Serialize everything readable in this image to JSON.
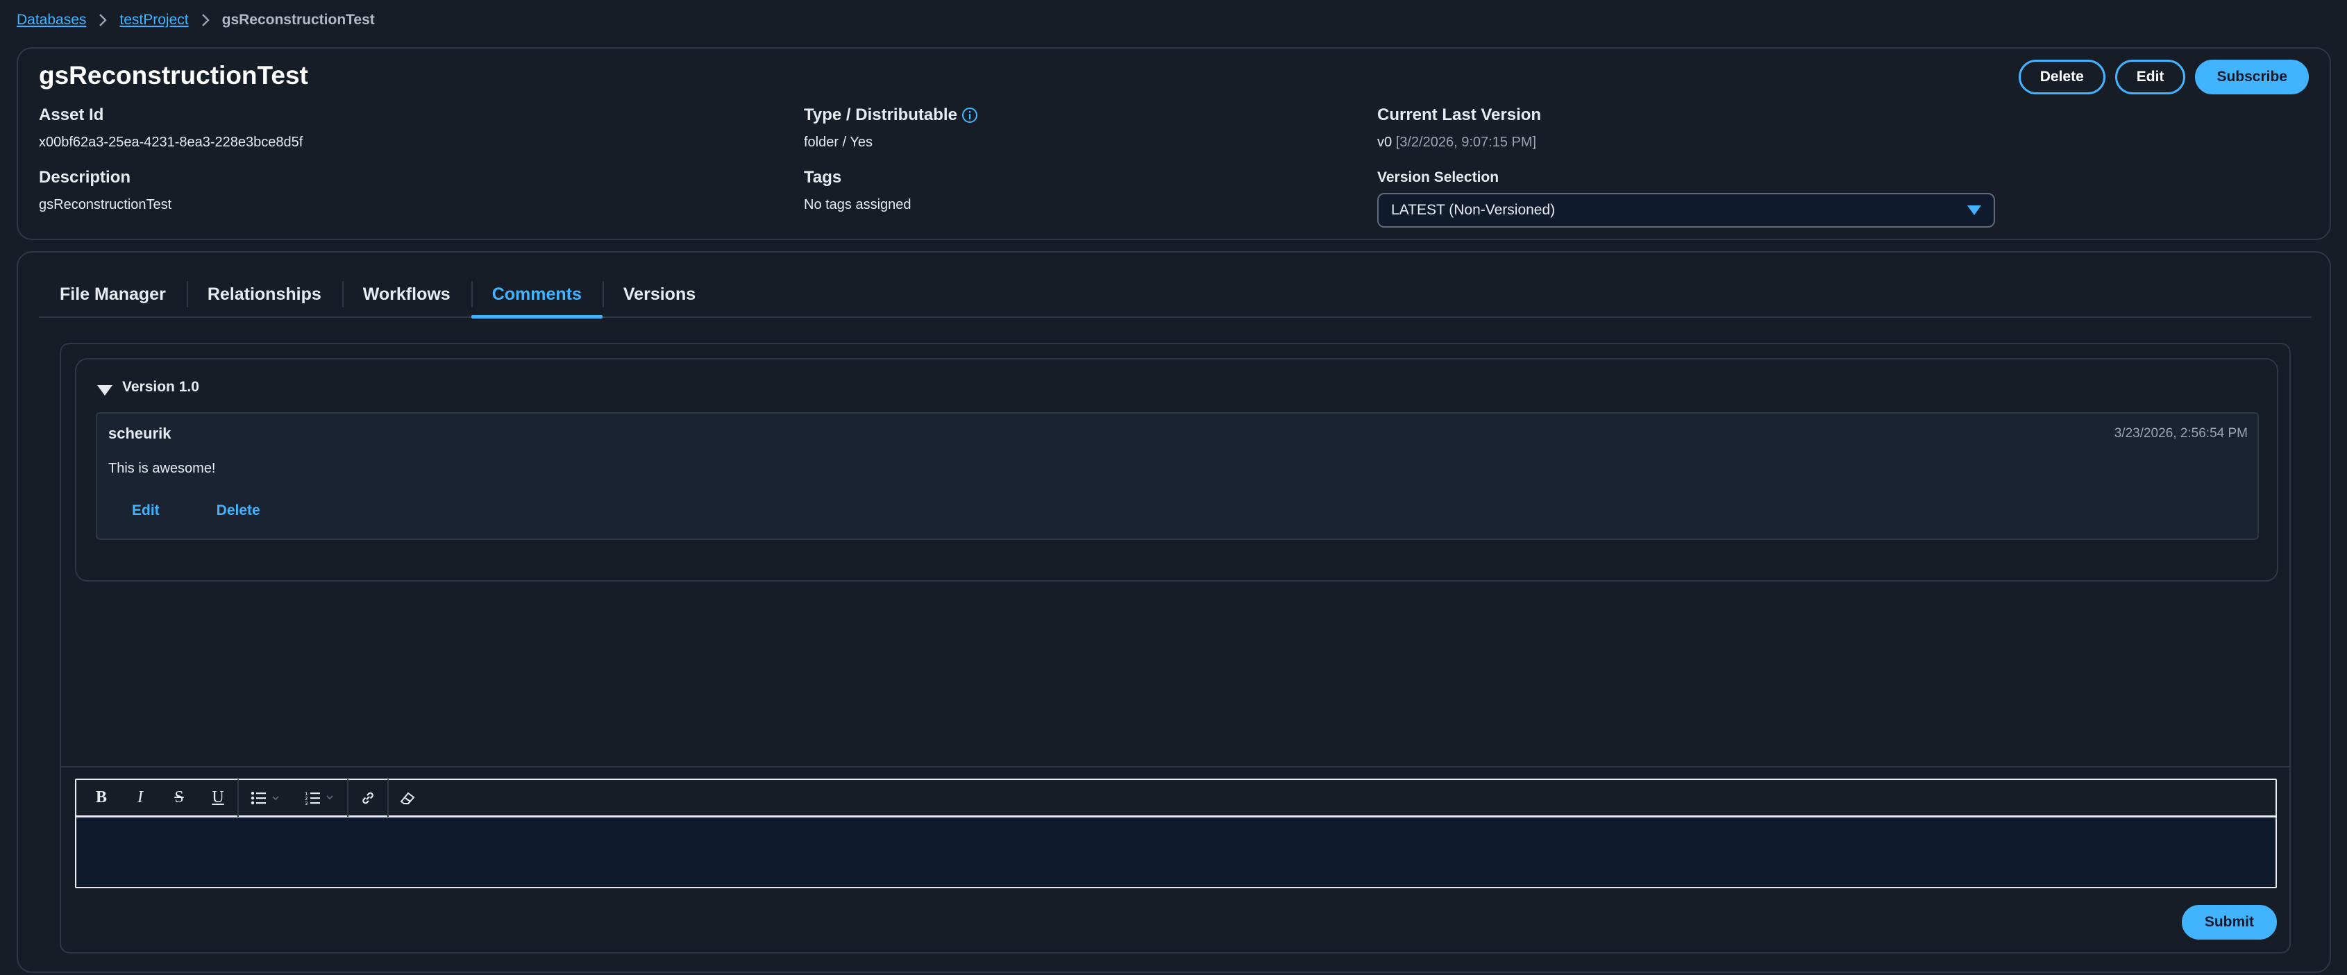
{
  "breadcrumb": {
    "items": [
      {
        "label": "Databases"
      },
      {
        "label": "testProject"
      }
    ],
    "current": "gsReconstructionTest"
  },
  "asset": {
    "title": "gsReconstructionTest",
    "actions": {
      "delete": "Delete",
      "edit": "Edit",
      "subscribe": "Subscribe"
    },
    "fields": {
      "asset_id": {
        "label": "Asset Id",
        "value": "x00bf62a3-25ea-4231-8ea3-228e3bce8d5f"
      },
      "type": {
        "label": "Type / Distributable",
        "value": "folder / Yes"
      },
      "current_version": {
        "label": "Current Last Version",
        "version": "v0",
        "date": "[3/2/2026, 9:07:15 PM]"
      },
      "description": {
        "label": "Description",
        "value": "gsReconstructionTest"
      },
      "tags": {
        "label": "Tags",
        "value": "No tags assigned"
      },
      "version_selection": {
        "label": "Version Selection",
        "value": "LATEST (Non-Versioned)"
      }
    }
  },
  "tabs": [
    {
      "label": "File Manager",
      "active": false
    },
    {
      "label": "Relationships",
      "active": false
    },
    {
      "label": "Workflows",
      "active": false
    },
    {
      "label": "Comments",
      "active": true
    },
    {
      "label": "Versions",
      "active": false
    }
  ],
  "comments": {
    "groups": [
      {
        "title": "Version 1.0",
        "comments": [
          {
            "author": "scheurik",
            "timestamp": "3/23/2026, 2:56:54 PM",
            "body": "This is awesome!",
            "edit_label": "Edit",
            "delete_label": "Delete"
          }
        ]
      }
    ],
    "editor": {
      "tools": [
        "bold-icon",
        "italic-icon",
        "strikethrough-icon",
        "underline-icon",
        "bulleted-list-icon",
        "numbered-list-icon",
        "link-icon",
        "clear-formatting-icon"
      ]
    },
    "submit_label": "Submit"
  },
  "colors": {
    "accent": "#42b4ff",
    "background": "#161d26",
    "border": "#2e3844",
    "input_background": "#0f1b2d"
  }
}
